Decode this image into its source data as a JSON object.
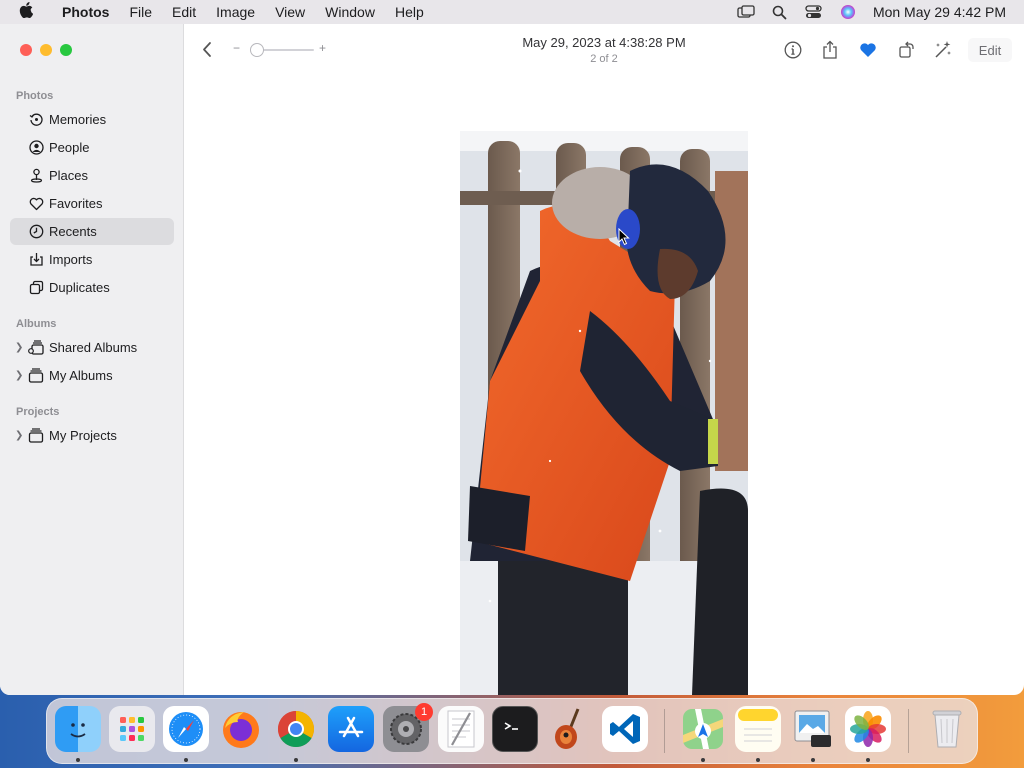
{
  "menubar": {
    "app_name": "Photos",
    "items": [
      "File",
      "Edit",
      "Image",
      "View",
      "Window",
      "Help"
    ],
    "clock": "Mon May 29  4:42 PM"
  },
  "sidebar": {
    "photos_section": "Photos",
    "photos_items": [
      {
        "label": "Memories",
        "icon": "memories-icon"
      },
      {
        "label": "People",
        "icon": "people-icon"
      },
      {
        "label": "Places",
        "icon": "places-icon"
      },
      {
        "label": "Favorites",
        "icon": "heart-icon"
      },
      {
        "label": "Recents",
        "icon": "clock-icon",
        "selected": true
      },
      {
        "label": "Imports",
        "icon": "import-icon"
      },
      {
        "label": "Duplicates",
        "icon": "duplicates-icon"
      }
    ],
    "albums_section": "Albums",
    "albums_items": [
      {
        "label": "Shared Albums",
        "icon": "shared-albums-icon"
      },
      {
        "label": "My Albums",
        "icon": "album-icon"
      }
    ],
    "projects_section": "Projects",
    "projects_items": [
      {
        "label": "My Projects",
        "icon": "project-icon"
      }
    ]
  },
  "toolbar": {
    "zoom_minus": "−",
    "zoom_plus": "+",
    "title": "May 29, 2023 at 4:38:28 PM",
    "subtitle": "2 of 2",
    "edit_label": "Edit",
    "favorite_color": "#1b74e4"
  },
  "dock": {
    "apps": [
      "Finder",
      "Launchpad",
      "Safari",
      "Firefox",
      "Chrome",
      "App Store",
      "System Settings",
      "TextEdit",
      "Terminal",
      "Instruments",
      "Visual Studio Code",
      "Maps",
      "Notes",
      "Preview",
      "Photos",
      "Trash"
    ],
    "settings_badge": "1"
  }
}
